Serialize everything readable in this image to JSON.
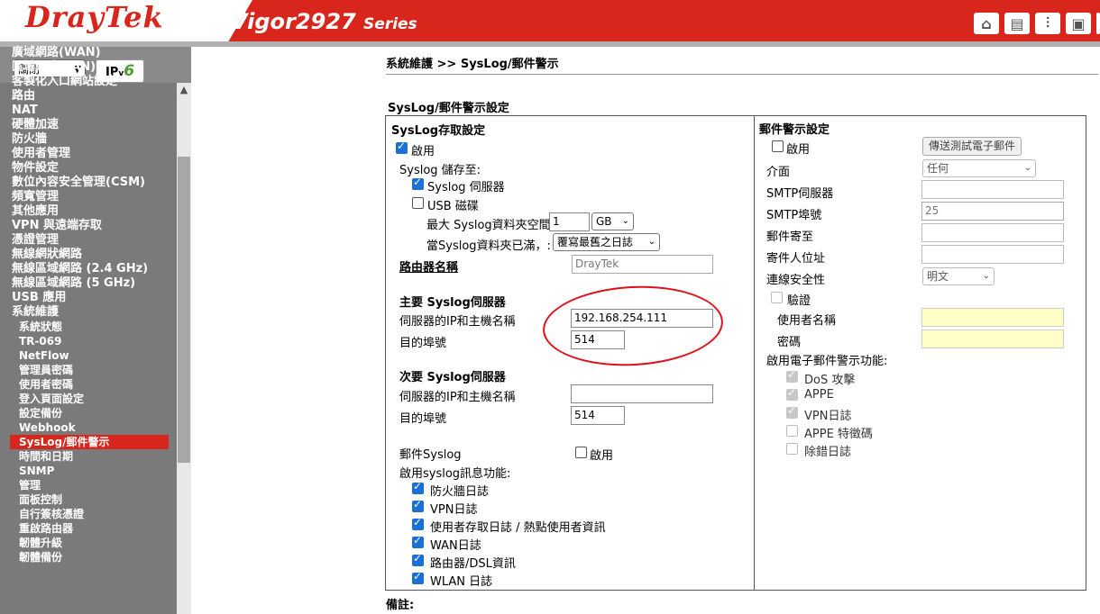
{
  "header": {
    "brand": "DrayTek",
    "model": "Vigor2927",
    "series": "Series",
    "icons": [
      "home-icon",
      "window-icon",
      "sliders-icon",
      "save-icon"
    ]
  },
  "sidebar": {
    "lang_value": "關閉",
    "ipv6_label": "IP",
    "ipv6_v": "v",
    "ipv6_six": "6",
    "menu": [
      {
        "label": "廣域網路(WAN)",
        "sub": false
      },
      {
        "label": "區域網路(LAN)",
        "sub": false
      },
      {
        "label": "客製化入口網站設定",
        "sub": false
      },
      {
        "label": "路由",
        "sub": false
      },
      {
        "label": "NAT",
        "sub": false
      },
      {
        "label": "硬體加速",
        "sub": false
      },
      {
        "label": "防火牆",
        "sub": false
      },
      {
        "label": "使用者管理",
        "sub": false
      },
      {
        "label": "物件設定",
        "sub": false
      },
      {
        "label": "數位內容安全管理(CSM)",
        "sub": false
      },
      {
        "label": "頻寬管理",
        "sub": false
      },
      {
        "label": "其他應用",
        "sub": false
      },
      {
        "label": "VPN 與遠端存取",
        "sub": false
      },
      {
        "label": "憑證管理",
        "sub": false
      },
      {
        "label": "無線網狀網路",
        "sub": false
      },
      {
        "label": "無線區域網路 (2.4 GHz)",
        "sub": false
      },
      {
        "label": "無線區域網路 (5 GHz)",
        "sub": false
      },
      {
        "label": "USB 應用",
        "sub": false
      },
      {
        "label": "系統維護",
        "sub": false
      },
      {
        "label": "系統狀態",
        "sub": true
      },
      {
        "label": "TR-069",
        "sub": true
      },
      {
        "label": "NetFlow",
        "sub": true
      },
      {
        "label": "管理員密碼",
        "sub": true
      },
      {
        "label": "使用者密碼",
        "sub": true
      },
      {
        "label": "登入頁面設定",
        "sub": true
      },
      {
        "label": "設定備份",
        "sub": true
      },
      {
        "label": "Webhook",
        "sub": true
      },
      {
        "label": "SysLog/郵件警示",
        "sub": true,
        "active": true
      },
      {
        "label": "時間和日期",
        "sub": true
      },
      {
        "label": "SNMP",
        "sub": true
      },
      {
        "label": "管理",
        "sub": true
      },
      {
        "label": "面板控制",
        "sub": true
      },
      {
        "label": "自行簽核憑證",
        "sub": true
      },
      {
        "label": "重啟路由器",
        "sub": true
      },
      {
        "label": "韌體升級",
        "sub": true
      },
      {
        "label": "韌體備份",
        "sub": true
      }
    ]
  },
  "main": {
    "breadcrumb": "系統維護 >> SysLog/郵件警示",
    "section_title": "SysLog/郵件警示設定",
    "syslog": {
      "heading": "SysLog存取設定",
      "enable_label": "啟用",
      "save_to_label": "Syslog 儲存至:",
      "syslog_server_label": "Syslog 伺服器",
      "usb_disk_label": "USB 磁碟",
      "max_space_label": "最大 Syslog資料夾空間",
      "max_space_value": "1",
      "unit_value": "GB",
      "when_full_label": "當Syslog資料夾已滿，:",
      "when_full_value": "覆寫最舊之日誌",
      "router_name_label": "路由器名稱",
      "router_name_placeholder": "DrayTek",
      "primary_heading": "主要 Syslog伺服器",
      "primary_ip_label": "伺服器的IP和主機名稱",
      "primary_ip_value": "192.168.254.111",
      "primary_port_label": "目的埠號",
      "primary_port_value": "514",
      "secondary_heading": "次要 Syslog伺服器",
      "secondary_ip_label": "伺服器的IP和主機名稱",
      "secondary_ip_value": "",
      "secondary_port_label": "目的埠號",
      "secondary_port_value": "514",
      "mail_syslog_label": "郵件Syslog",
      "mail_syslog_enable": "啟用",
      "features_label": "啟用syslog訊息功能:",
      "features": [
        "防火牆日誌",
        "VPN日誌",
        "使用者存取日誌 / 熱點使用者資訊",
        "WAN日誌",
        "路由器/DSL資訊",
        "WLAN 日誌"
      ]
    },
    "mail": {
      "heading": "郵件警示設定",
      "enable_label": "啟用",
      "send_test_button": "傳送測試電子郵件",
      "interface_label": "介面",
      "interface_value": "任何",
      "smtp_server_label": "SMTP伺服器",
      "smtp_port_label": "SMTP埠號",
      "smtp_port_placeholder": "25",
      "mail_to_label": "郵件寄至",
      "sender_label": "寄件人位址",
      "security_label": "連線安全性",
      "security_value": "明文",
      "auth_label": "驗證",
      "username_label": "使用者名稱",
      "password_label": "密碼",
      "alert_features_label": "啟用電子郵件警示功能:",
      "alert_features": [
        "DoS 攻擊",
        "APPE",
        "VPN日誌",
        "APPE 特徵碼",
        "除錯日誌"
      ]
    },
    "remarks_label": "備註:"
  },
  "colors": {
    "brand_red": "#d9261c",
    "checkbox_blue": "#1a6fd8",
    "annotation_red": "#e0111b"
  }
}
